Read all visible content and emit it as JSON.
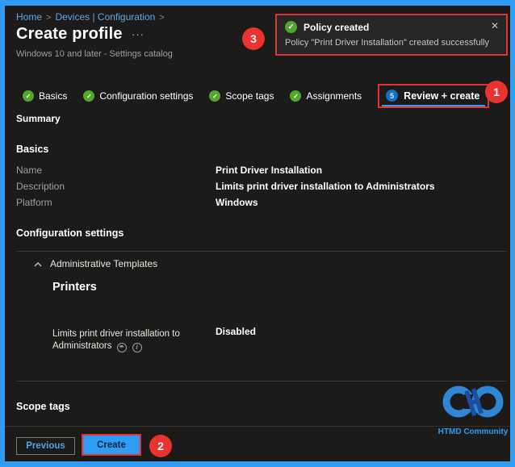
{
  "colors": {
    "accent_blue": "#2f9bf3",
    "success_green": "#52a82e",
    "annotation_red": "#e8332e",
    "background": "#1c1b1a"
  },
  "icons": {
    "check": "✓",
    "close": "✕",
    "info": "i",
    "ellipsis": "···"
  },
  "breadcrumb": {
    "home": "Home",
    "section": "Devices | Configuration",
    "separator": ">"
  },
  "header": {
    "title": "Create profile",
    "subtitle": "Windows 10 and later - Settings catalog"
  },
  "toast": {
    "title": "Policy created",
    "message": "Policy \"Print Driver Installation\" created successfully"
  },
  "tabs": [
    {
      "label": "Basics"
    },
    {
      "label": "Configuration settings"
    },
    {
      "label": "Scope tags"
    },
    {
      "label": "Assignments"
    },
    {
      "label": "Review + create",
      "step": "5"
    }
  ],
  "annotations": {
    "step1": "1",
    "step2": "2",
    "step3": "3"
  },
  "summary": {
    "heading": "Summary"
  },
  "basics": {
    "heading": "Basics",
    "rows": [
      {
        "label": "Name",
        "value": "Print Driver Installation"
      },
      {
        "label": "Description",
        "value": "Limits print driver installation to Administrators"
      },
      {
        "label": "Platform",
        "value": "Windows"
      }
    ]
  },
  "configuration": {
    "heading": "Configuration settings",
    "group": "Administrative Templates",
    "category": "Printers",
    "setting_label": "Limits print driver installation to Administrators",
    "setting_value": "Disabled"
  },
  "scope_tags": {
    "heading": "Scope tags"
  },
  "footer": {
    "previous_label": "Previous",
    "create_label": "Create"
  },
  "logo": {
    "text": "HTMD Community"
  }
}
